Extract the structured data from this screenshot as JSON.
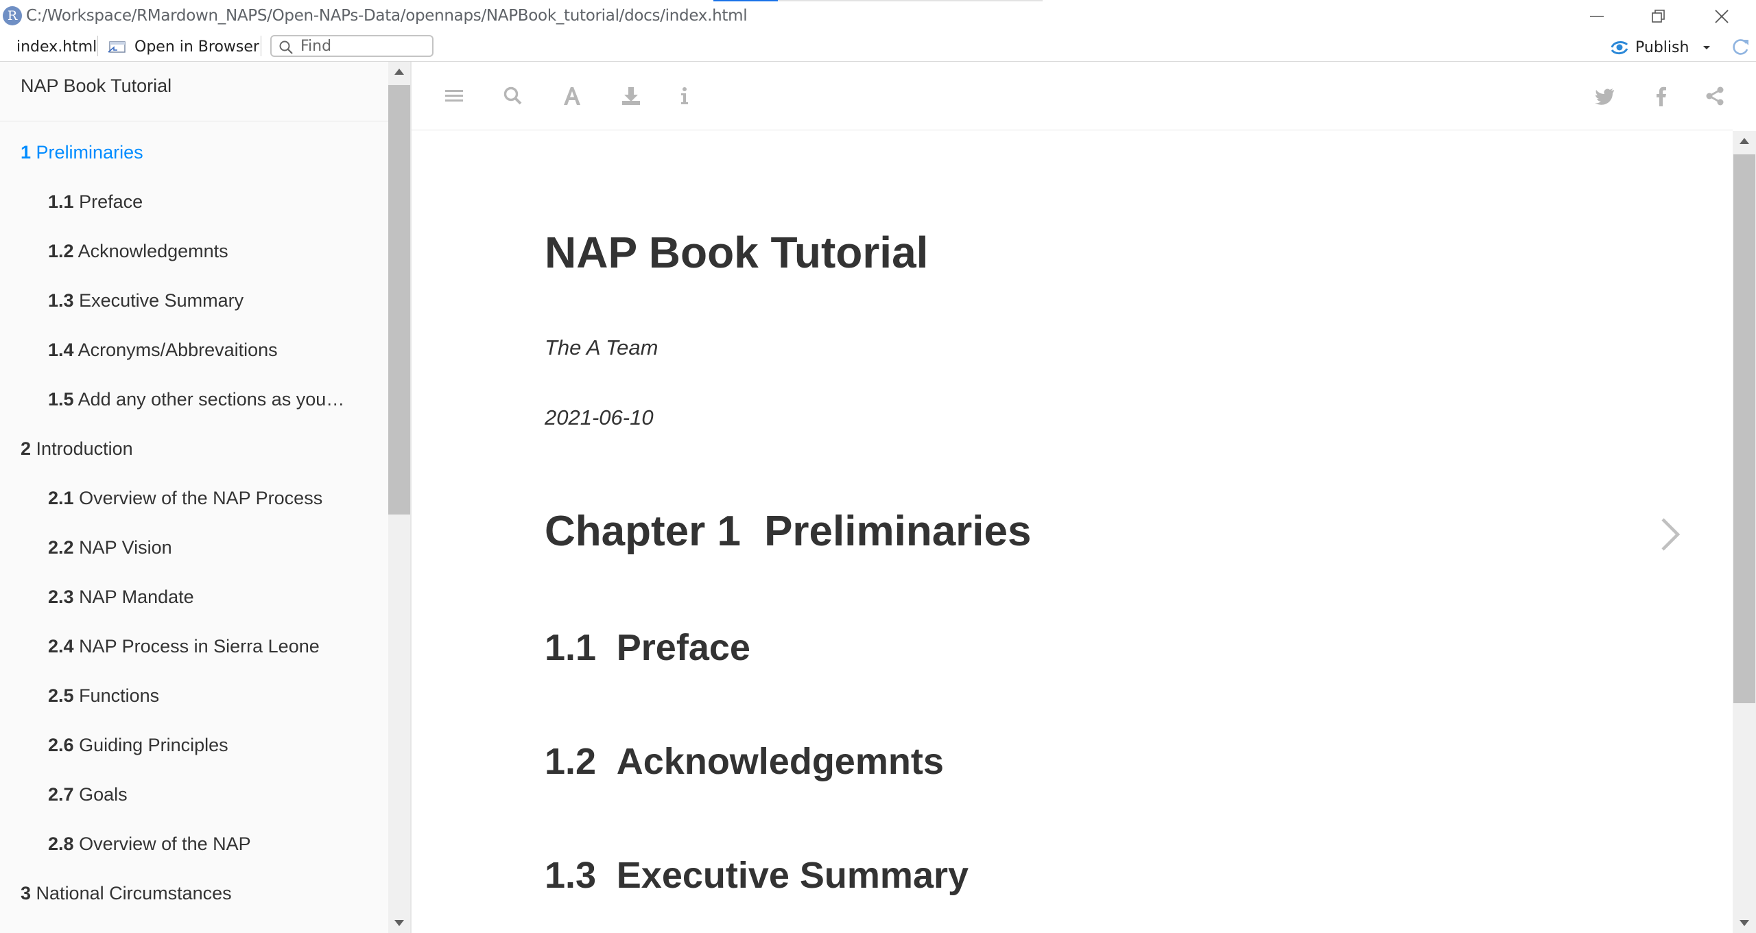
{
  "window": {
    "title_path": "C:/Workspace/RMardown_NAPS/Open-NAPs-Data/opennaps/NAPBook_tutorial/docs/index.html",
    "logo_letter": "R"
  },
  "toolbar": {
    "file_label": "index.html",
    "open_browser_label": "Open in Browser",
    "find_placeholder": "Find",
    "publish_label": "Publish"
  },
  "sidebar": {
    "title": "NAP Book Tutorial",
    "items": [
      {
        "num": "1",
        "label": "Preliminaries",
        "level": 1,
        "active": true
      },
      {
        "num": "1.1",
        "label": "Preface",
        "level": 2
      },
      {
        "num": "1.2",
        "label": "Acknowledgemnts",
        "level": 2
      },
      {
        "num": "1.3",
        "label": "Executive Summary",
        "level": 2
      },
      {
        "num": "1.4",
        "label": "Acronyms/Abbrevaitions",
        "level": 2
      },
      {
        "num": "1.5",
        "label": "Add any other sections as you…",
        "level": 2
      },
      {
        "num": "2",
        "label": "Introduction",
        "level": 1
      },
      {
        "num": "2.1",
        "label": "Overview of the NAP Process",
        "level": 2
      },
      {
        "num": "2.2",
        "label": "NAP Vision",
        "level": 2
      },
      {
        "num": "2.3",
        "label": "NAP Mandate",
        "level": 2
      },
      {
        "num": "2.4",
        "label": "NAP Process in Sierra Leone",
        "level": 2
      },
      {
        "num": "2.5",
        "label": "Functions",
        "level": 2
      },
      {
        "num": "2.6",
        "label": "Guiding Principles",
        "level": 2
      },
      {
        "num": "2.7",
        "label": "Goals",
        "level": 2
      },
      {
        "num": "2.8",
        "label": "Overview of the NAP",
        "level": 2
      },
      {
        "num": "3",
        "label": "National Circumstances",
        "level": 1
      }
    ]
  },
  "book_toolbar": {
    "left_icons": [
      "menu-icon",
      "search-icon",
      "font-icon",
      "download-icon",
      "info-icon"
    ],
    "right_icons": [
      "twitter-icon",
      "facebook-icon",
      "share-icon"
    ]
  },
  "content": {
    "book_title": "NAP Book Tutorial",
    "author": "The A Team",
    "date": "2021-06-10",
    "chapter": {
      "num": "Chapter 1",
      "title": "Preliminaries"
    },
    "sections": [
      {
        "num": "1.1",
        "title": "Preface"
      },
      {
        "num": "1.2",
        "title": "Acknowledgemnts"
      },
      {
        "num": "1.3",
        "title": "Executive Summary"
      }
    ]
  },
  "colors": {
    "accent": "#008cff",
    "text": "#333333",
    "sidebar_bg": "#fafafa",
    "icon_gray": "#b6b6b6"
  }
}
